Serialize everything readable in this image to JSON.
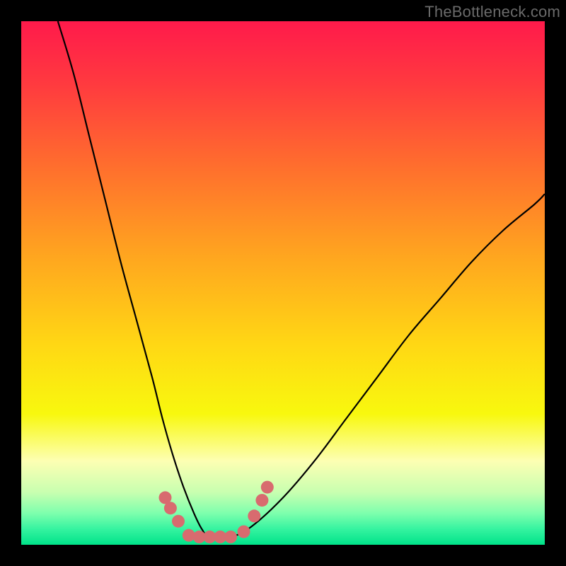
{
  "watermark": {
    "text": "TheBottleneck.com"
  },
  "chart_data": {
    "type": "line",
    "title": "",
    "xlabel": "",
    "ylabel": "",
    "xlim": [
      0,
      100
    ],
    "ylim": [
      0,
      100
    ],
    "series": [
      {
        "name": "bottleneck-curve",
        "x": [
          7,
          10,
          13,
          16,
          19,
          22,
          25,
          27,
          29,
          31,
          33,
          34.5,
          36,
          40,
          44,
          50,
          56,
          62,
          68,
          74,
          80,
          86,
          92,
          98,
          100
        ],
        "y": [
          100,
          90,
          78,
          66,
          54,
          43,
          32,
          24,
          17,
          11,
          6,
          3,
          1.5,
          1.5,
          3.5,
          9,
          16,
          24,
          32,
          40,
          47,
          54,
          60,
          65,
          67
        ]
      }
    ],
    "threshold_band": {
      "ymin": 0,
      "ymax": 5,
      "color": "#00e38a"
    },
    "markers": {
      "name": "tolerance-markers",
      "color": "#d86b6f",
      "points": [
        {
          "x": 27.5,
          "y": 9.0
        },
        {
          "x": 28.5,
          "y": 7.0
        },
        {
          "x": 30.0,
          "y": 4.5
        },
        {
          "x": 32.0,
          "y": 1.8
        },
        {
          "x": 34.0,
          "y": 1.5
        },
        {
          "x": 36.0,
          "y": 1.5
        },
        {
          "x": 38.0,
          "y": 1.5
        },
        {
          "x": 40.0,
          "y": 1.5
        },
        {
          "x": 42.5,
          "y": 2.5
        },
        {
          "x": 44.5,
          "y": 5.5
        },
        {
          "x": 46.0,
          "y": 8.5
        },
        {
          "x": 47.0,
          "y": 11.0
        }
      ]
    },
    "background_gradient": {
      "stops": [
        {
          "offset": 0.0,
          "color": "#ff1a4b"
        },
        {
          "offset": 0.12,
          "color": "#ff3a3f"
        },
        {
          "offset": 0.28,
          "color": "#ff6f2d"
        },
        {
          "offset": 0.45,
          "color": "#ffa61f"
        },
        {
          "offset": 0.62,
          "color": "#ffd814"
        },
        {
          "offset": 0.75,
          "color": "#f8f80e"
        },
        {
          "offset": 0.84,
          "color": "#fdffb3"
        },
        {
          "offset": 0.9,
          "color": "#c8ffb0"
        },
        {
          "offset": 0.94,
          "color": "#7dffad"
        },
        {
          "offset": 0.97,
          "color": "#35f3a0"
        },
        {
          "offset": 1.0,
          "color": "#00e38a"
        }
      ]
    }
  }
}
